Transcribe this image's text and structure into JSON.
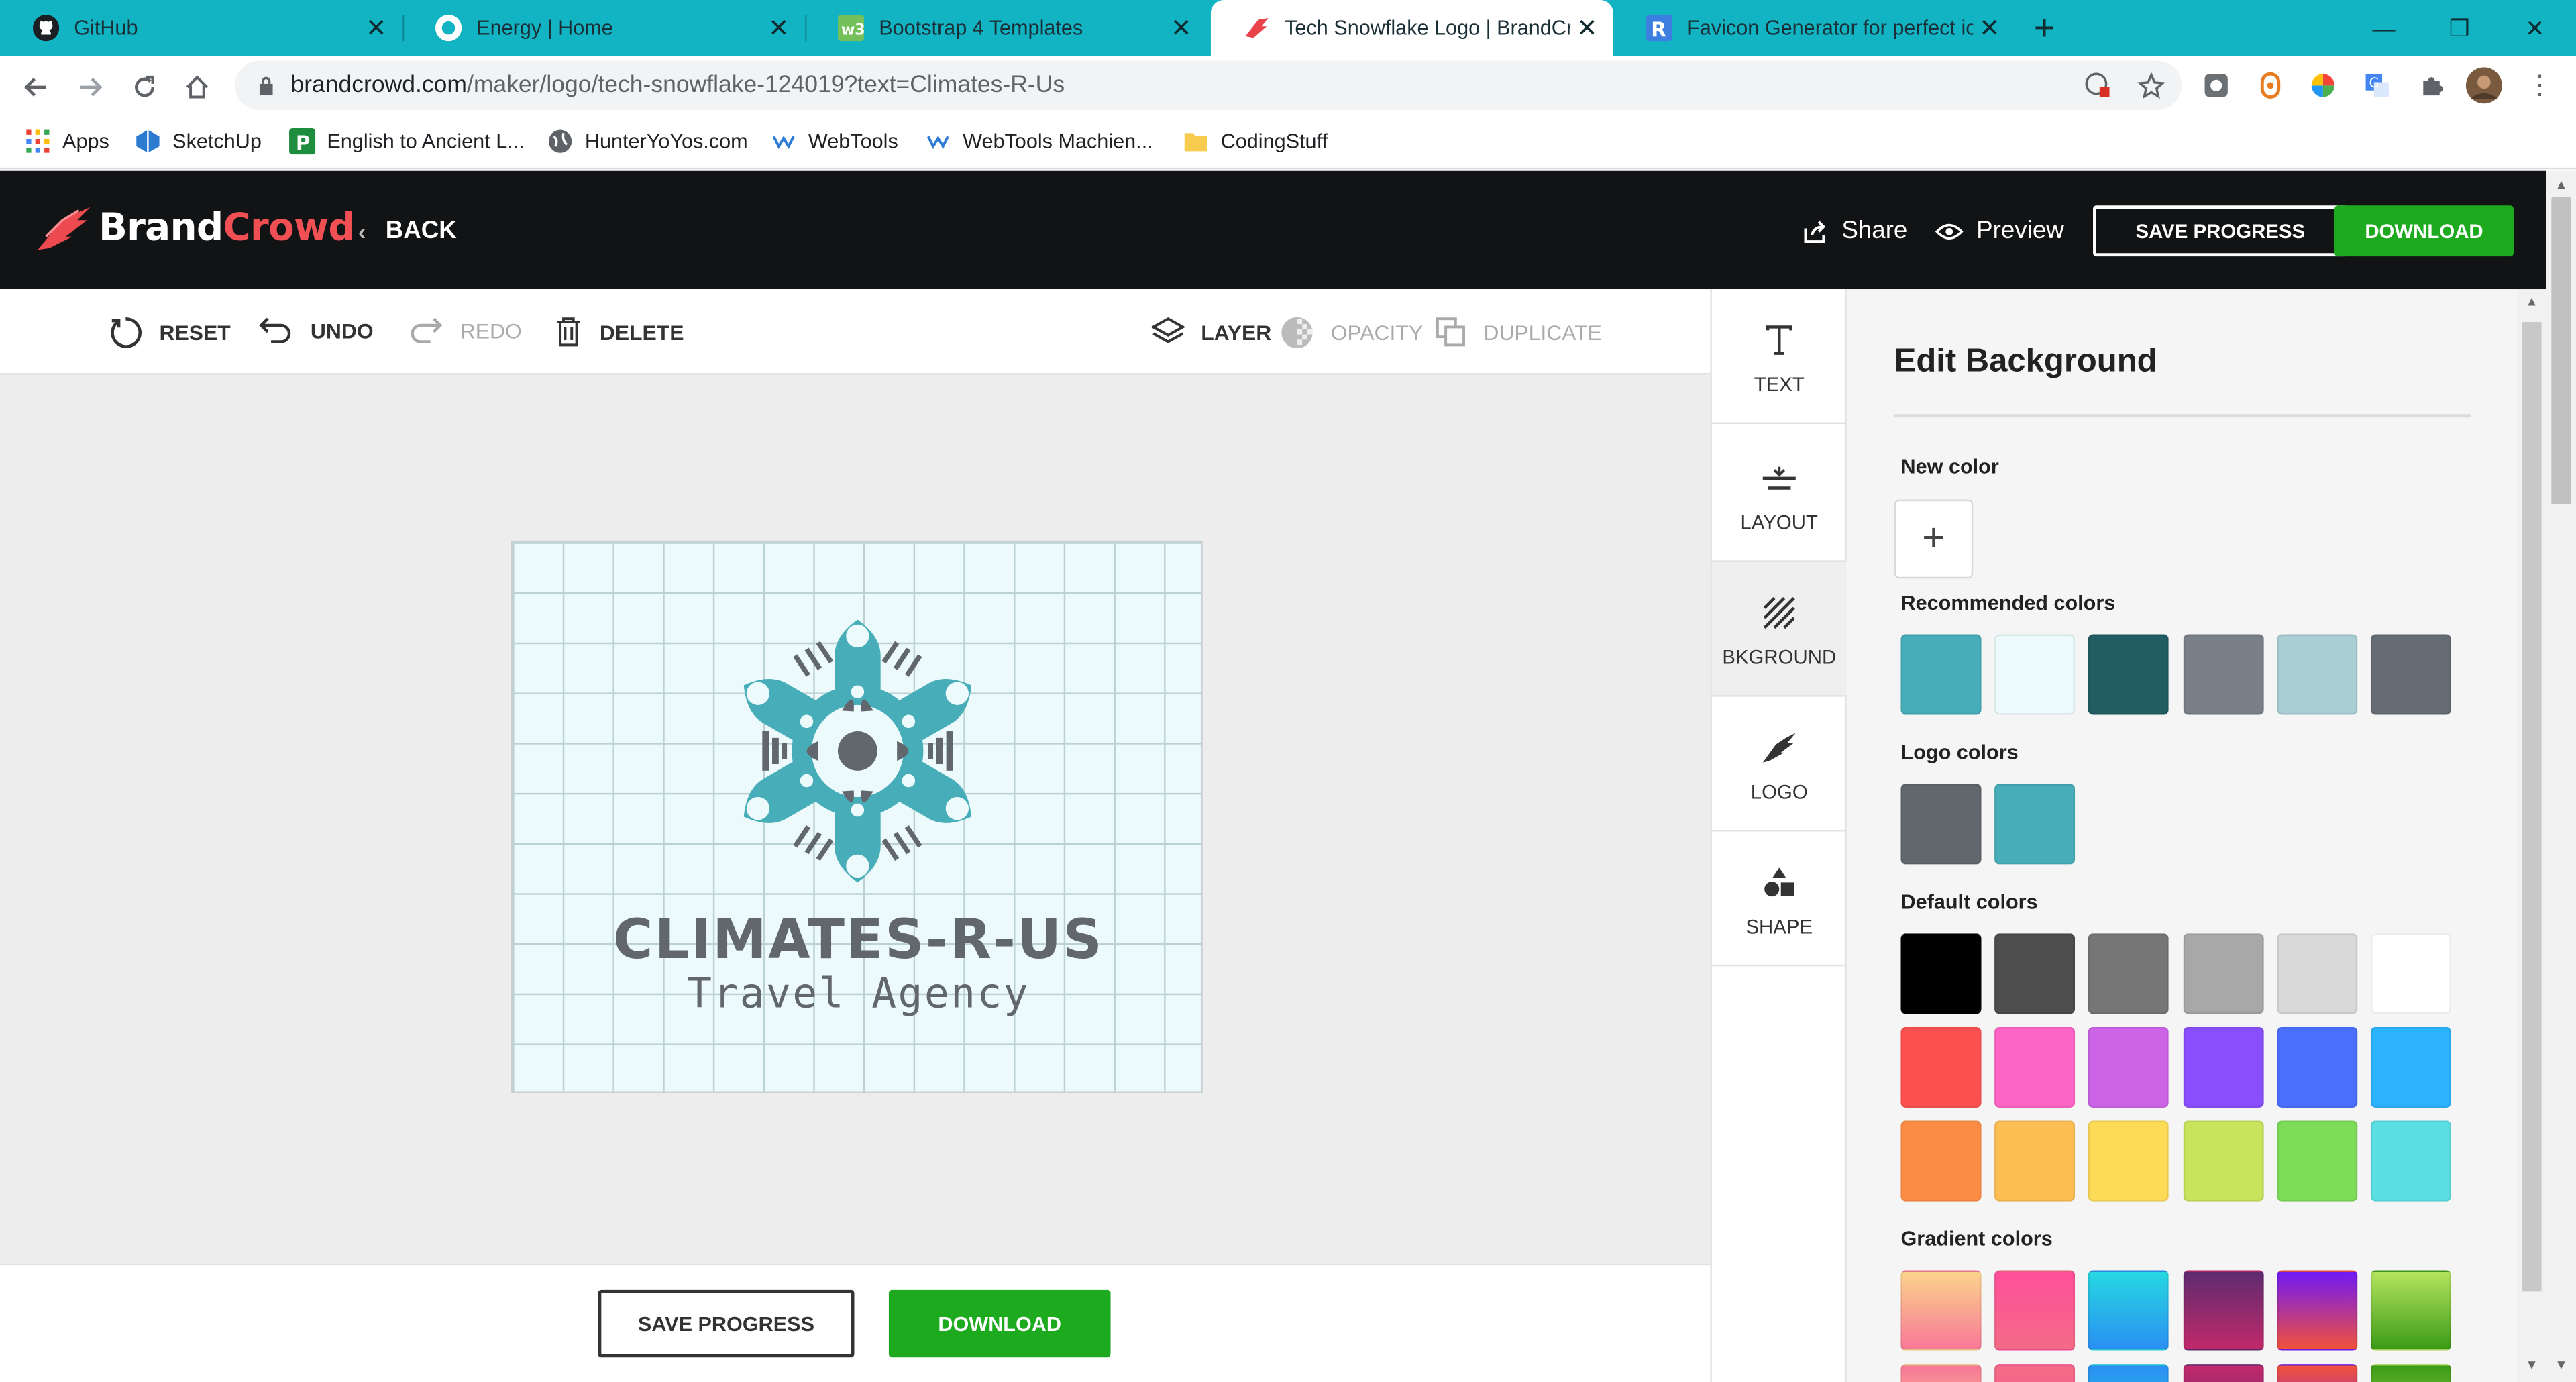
{
  "browser": {
    "tabs": [
      {
        "title": "GitHub",
        "icon": "github-icon",
        "active": false
      },
      {
        "title": "Energy | Home",
        "icon": "energy-icon",
        "active": false
      },
      {
        "title": "Bootstrap 4 Templates",
        "icon": "w3-icon",
        "active": false
      },
      {
        "title": "Tech Snowflake Logo | BrandCrowd",
        "icon": "brandcrowd-icon",
        "active": true
      },
      {
        "title": "Favicon Generator for perfect icons",
        "icon": "realfavicon-icon",
        "active": false
      }
    ],
    "url_host": "brandcrowd.com",
    "url_path": "/maker/logo/tech-snowflake-124019?text=Climates-R-Us",
    "bookmarks": [
      {
        "label": "Apps",
        "icon": "apps-grid-icon"
      },
      {
        "label": "SketchUp",
        "icon": "sketchup-icon"
      },
      {
        "label": "English to Ancient L...",
        "icon": "translate-p-icon"
      },
      {
        "label": "HunterYoYos.com",
        "icon": "globe-icon"
      },
      {
        "label": "WebTools",
        "icon": "webtools-icon"
      },
      {
        "label": "WebTools Machien...",
        "icon": "webtools-icon"
      },
      {
        "label": "CodingStuff",
        "icon": "folder-icon"
      }
    ],
    "theme_color": "#12b3c3"
  },
  "header": {
    "brand_part1": "Brand",
    "brand_part2": "Crowd",
    "back_label": "BACK",
    "share_label": "Share",
    "preview_label": "Preview",
    "save_label": "SAVE PROGRESS",
    "download_label": "DOWNLOAD"
  },
  "edit_toolbar": {
    "reset": "RESET",
    "undo": "UNDO",
    "redo": "REDO",
    "delete": "DELETE",
    "layer": "LAYER",
    "opacity": "OPACITY",
    "duplicate": "DUPLICATE"
  },
  "logo": {
    "title": "CLIMATES-R-US",
    "subtitle": "Travel Agency",
    "primary_color": "#47adb9",
    "text_color": "#62676e",
    "background_color": "#ecfafb"
  },
  "bottom_bar": {
    "save_label": "SAVE PROGRESS",
    "download_label": "DOWNLOAD"
  },
  "rail": [
    {
      "label": "TEXT",
      "icon": "text-t-icon"
    },
    {
      "label": "LAYOUT",
      "icon": "layout-icon"
    },
    {
      "label": "BKGROUND",
      "icon": "background-hatch-icon"
    },
    {
      "label": "LOGO",
      "icon": "logo-feather-icon"
    },
    {
      "label": "SHAPE",
      "icon": "shapes-icon"
    }
  ],
  "panel": {
    "title": "Edit Background",
    "new_color_label": "New color",
    "recommended_label": "Recommended colors",
    "recommended_colors": [
      "#47adb9",
      "#ecfafb",
      "#215d63",
      "#7a8087",
      "#a9ced4",
      "#656c75"
    ],
    "logo_colors_label": "Logo colors",
    "logo_colors": [
      "#62676e",
      "#47adb9"
    ],
    "default_colors_label": "Default colors",
    "default_colors": [
      [
        "#000000",
        "#4d4d4d",
        "#767676",
        "#a8a8a8",
        "#d9d9d9",
        "#ffffff"
      ],
      [
        "#fd5151",
        "#fd65c6",
        "#cd64e8",
        "#8a4ffc",
        "#4a6ffd",
        "#2cb3fd"
      ],
      [
        "#fd8c45",
        "#fdbe54",
        "#fddb56",
        "#c8e35c",
        "#7ddc58",
        "#5adfe3"
      ]
    ],
    "gradient_colors_label": "Gradient colors",
    "gradient_colors": [
      [
        "#fbd38d",
        "#f87896"
      ],
      [
        "#ff4f9b",
        "#f36b86"
      ],
      [
        "#26d8e1",
        "#2a8ff3"
      ],
      [
        "#5e2b6e",
        "#c1296b"
      ],
      [
        "#6f19f5",
        "#f2523a"
      ],
      [
        "#b5e45e",
        "#3b9b16"
      ]
    ]
  }
}
